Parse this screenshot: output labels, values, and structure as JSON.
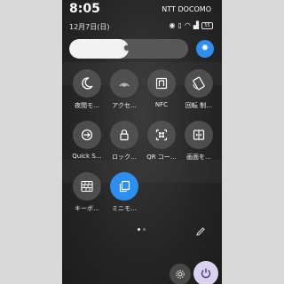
{
  "status_bar": {
    "time": "8:05",
    "carrier": "NTT DOCOMO",
    "date": "12月7日(日)",
    "battery": "55"
  },
  "brightness": {
    "level": 0.5
  },
  "tiles": [
    {
      "label": "夜間モ…",
      "icon": "moon-icon",
      "active": false
    },
    {
      "label": "アクセ…",
      "icon": "accessibility-icon",
      "active": false
    },
    {
      "label": "NFC",
      "icon": "nfc-icon",
      "active": false
    },
    {
      "label": "回転 制…",
      "icon": "rotation-lock-icon",
      "active": false
    },
    {
      "label": "Quick S…",
      "icon": "quick-share-icon",
      "active": false
    },
    {
      "label": "ロック…",
      "icon": "lock-icon",
      "active": false
    },
    {
      "label": "QR コー…",
      "icon": "qr-scan-icon",
      "active": false
    },
    {
      "label": "画面を…",
      "icon": "screen-split-icon",
      "active": false
    },
    {
      "label": "キーボ…",
      "icon": "keyboard-icon",
      "active": false
    },
    {
      "label": "ミニモ…",
      "icon": "mini-mode-icon",
      "active": true
    }
  ],
  "colors": {
    "accent": "#2b8ef0",
    "tile": "#555555",
    "power_bg": "#d9d3ee"
  }
}
